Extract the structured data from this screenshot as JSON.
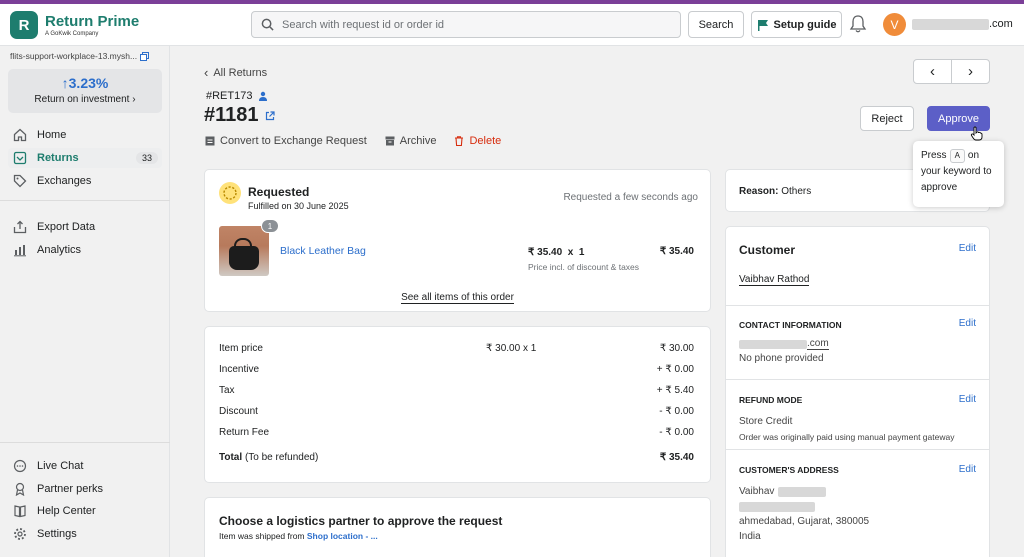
{
  "app": {
    "name": "Return Prime",
    "tagline": "A GoKwik Company",
    "search_placeholder": "Search with request id or order id",
    "search_button": "Search",
    "setup_guide": "Setup guide",
    "avatar_initial": "V",
    "user_email_suffix": ".com"
  },
  "sidebar": {
    "store": "flits-support-workplace-13.mysh...",
    "roi_value": "3.23%",
    "roi_label": "Return on investment",
    "items": [
      {
        "label": "Home"
      },
      {
        "label": "Returns",
        "badge": "33"
      },
      {
        "label": "Exchanges"
      },
      {
        "label": "Export Data"
      },
      {
        "label": "Analytics"
      }
    ],
    "footer": [
      {
        "label": "Live Chat"
      },
      {
        "label": "Partner perks"
      },
      {
        "label": "Help Center"
      },
      {
        "label": "Settings"
      }
    ]
  },
  "header": {
    "back": "All Returns",
    "return_id": "#RET173",
    "order_number": "#1181",
    "actions": {
      "convert": "Convert to Exchange Request",
      "archive": "Archive",
      "delete": "Delete"
    },
    "reject": "Reject",
    "approve": "Approve"
  },
  "tooltip": {
    "press": "Press",
    "key": "A",
    "rest": "on your keyword to approve"
  },
  "request": {
    "status": "Requested",
    "fulfilled": "Fulfilled on 30 June 2025",
    "time": "Requested a few seconds ago",
    "item_qty": "1",
    "item_name": "Black Leather Bag",
    "item_price": "₹ 35.40  x  1",
    "item_price_note": "Price incl. of discount & taxes",
    "item_total": "₹ 35.40",
    "see_all": "See all items of this order"
  },
  "summary": [
    {
      "label": "Item price",
      "mid": "₹ 30.00 x 1",
      "value": "₹ 30.00"
    },
    {
      "label": "Incentive",
      "mid": "",
      "value": "+ ₹ 0.00"
    },
    {
      "label": "Tax",
      "mid": "",
      "value": "+ ₹ 5.40"
    },
    {
      "label": "Discount",
      "mid": "",
      "value": "- ₹ 0.00"
    },
    {
      "label": "Return Fee",
      "mid": "",
      "value": "- ₹ 0.00"
    }
  ],
  "summary_total": {
    "label": "Total",
    "note": "(To be refunded)",
    "value": "₹ 35.40"
  },
  "logistics": {
    "title": "Choose a logistics partner to approve the request",
    "sub": "Item was shipped from",
    "link": "Shop location - ..."
  },
  "reason": {
    "label": "Reason:",
    "value": "Others"
  },
  "customer": {
    "title": "Customer",
    "edit": "Edit",
    "name": "Vaibhav Rathod",
    "contact_title": "CONTACT INFORMATION",
    "email_suffix": ".com",
    "phone": "No phone provided",
    "refund_title": "REFUND MODE",
    "refund_mode": "Store Credit",
    "refund_note": "Order was originally paid using manual payment gateway",
    "address_title": "CUSTOMER'S ADDRESS",
    "address_first": "Vaibhav",
    "address_city": "ahmedabad, Gujarat, 380005",
    "address_country": "India"
  }
}
